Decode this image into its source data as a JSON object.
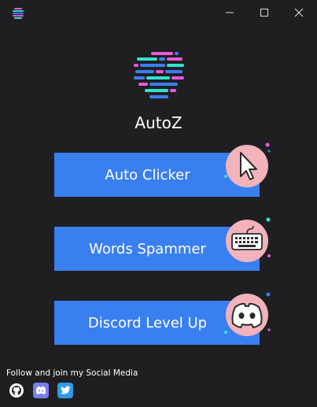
{
  "app": {
    "name": "AutoZ"
  },
  "window": {
    "minimize": "—",
    "maximize": "☐",
    "close": "✕"
  },
  "buttons": [
    {
      "label": "Auto Clicker",
      "icon": "cursor-icon"
    },
    {
      "label": "Words Spammer",
      "icon": "keyboard-icon"
    },
    {
      "label": "Discord Level Up",
      "icon": "discord-icon"
    }
  ],
  "social": {
    "label": "Follow and join my Social Media",
    "links": [
      "github-icon",
      "discord-icon",
      "twitter-icon"
    ]
  },
  "colors": {
    "background": "#1f1f22",
    "button": "#3a7ff0",
    "badge": "#f2b3bb",
    "accent_pink": "#e85ad8",
    "accent_teal": "#34e0d0",
    "accent_blue": "#3a7ff0"
  }
}
